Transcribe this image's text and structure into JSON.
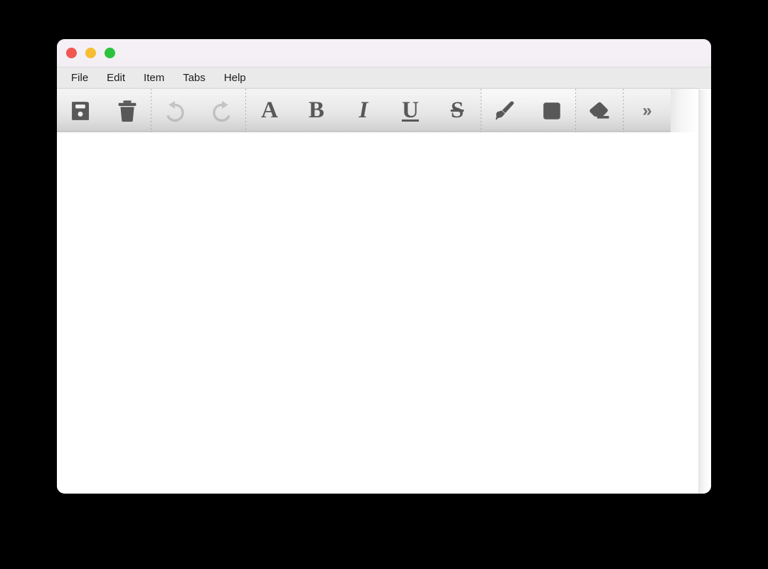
{
  "window": {
    "title": "",
    "traffic_lights": [
      {
        "name": "close",
        "label": "",
        "color": "#f05750"
      },
      {
        "name": "minimize",
        "label": "",
        "color": "#f7bd34"
      },
      {
        "name": "maximize",
        "label": "",
        "color": "#2dc23e"
      }
    ],
    "background_color": "#ffffff",
    "titlebar_color": "#f3eff4",
    "desktop_color": "#000000"
  },
  "menubar": {
    "background_color": "#eaeaea",
    "items": [
      {
        "label": "File"
      },
      {
        "label": "Edit"
      },
      {
        "label": "Item"
      },
      {
        "label": "Tabs"
      },
      {
        "label": "Help"
      }
    ]
  },
  "toolbar": {
    "icon_color": "#585858",
    "disabled_icon_color": "#b4b4b4",
    "groups": [
      {
        "name": "file-group",
        "highlighted": false,
        "buttons": [
          {
            "icon": "save-icon",
            "label": "Save",
            "enabled": true
          },
          {
            "icon": "trash-icon",
            "label": "Delete",
            "enabled": true
          }
        ]
      },
      {
        "name": "history-group",
        "highlighted": false,
        "buttons": [
          {
            "icon": "undo-icon",
            "label": "Undo",
            "enabled": false
          },
          {
            "icon": "redo-icon",
            "label": "Redo",
            "enabled": false
          }
        ]
      },
      {
        "name": "text-format-group",
        "highlighted": false,
        "buttons": [
          {
            "icon": "font-icon",
            "label": "Font",
            "glyph": "A",
            "enabled": true
          },
          {
            "icon": "bold-icon",
            "label": "Bold",
            "glyph": "B",
            "enabled": true
          },
          {
            "icon": "italic-icon",
            "label": "Italic",
            "glyph": "I",
            "enabled": true
          },
          {
            "icon": "underline-icon",
            "label": "Underline",
            "glyph": "U",
            "enabled": true
          },
          {
            "icon": "strikethrough-icon",
            "label": "Strikethrough",
            "glyph": "S",
            "enabled": true
          }
        ]
      },
      {
        "name": "paint-group",
        "highlighted": true,
        "buttons": [
          {
            "icon": "brush-icon",
            "label": "Brush",
            "enabled": true
          },
          {
            "icon": "color-swatch-icon",
            "label": "Color",
            "enabled": true
          }
        ]
      },
      {
        "name": "eraser-group",
        "highlighted": false,
        "buttons": [
          {
            "icon": "eraser-icon",
            "label": "Eraser",
            "enabled": true
          }
        ]
      },
      {
        "name": "overflow-group",
        "highlighted": false,
        "buttons": [
          {
            "icon": "chevron-double-right-icon",
            "label": "»",
            "enabled": true
          }
        ]
      }
    ]
  },
  "canvas": {
    "content": "",
    "background_color": "#ffffff"
  }
}
